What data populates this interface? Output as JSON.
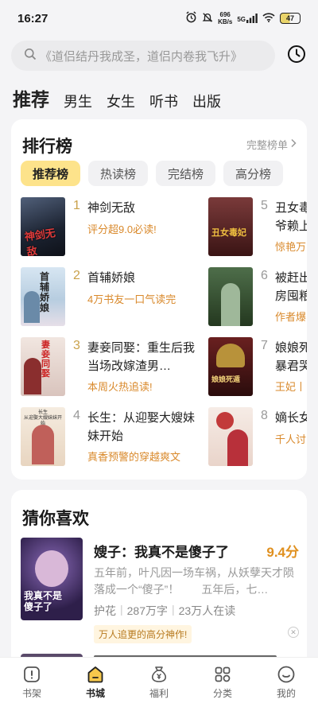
{
  "status": {
    "time": "16:27",
    "net_speed": "696",
    "net_unit": "KB/s",
    "signal": "5G",
    "battery": "47"
  },
  "search": {
    "placeholder": "《道侣结丹我成圣，道侣内卷我飞升》"
  },
  "tabs": [
    {
      "label": "推荐",
      "active": true
    },
    {
      "label": "男生"
    },
    {
      "label": "女生"
    },
    {
      "label": "听书"
    },
    {
      "label": "出版"
    }
  ],
  "ranking": {
    "title": "排行榜",
    "full_list_label": "完整榜单",
    "tabs": [
      "推荐榜",
      "热读榜",
      "完结榜",
      "高分榜"
    ],
    "items": [
      {
        "rank": "1",
        "name": "神剑无敌",
        "tag": "评分超9.0必读!",
        "cover_color": "#1f2a3a"
      },
      {
        "rank": "2",
        "name": "首辅娇娘",
        "tag": "4万书友一口气读完",
        "cover_color": "#cfe0ee"
      },
      {
        "rank": "3",
        "name": "妻妾同娶：重生后我当场改嫁渣男…",
        "tag": "本周火热追读!",
        "cover_color": "#e9dcd6"
      },
      {
        "rank": "4",
        "name": "长生：从迎娶大嫂妹妹开始",
        "tag": "真香预警的穿越爽文",
        "cover_color": "#efe2d2"
      },
      {
        "rank": "5",
        "name": "丑女毒",
        "name2": "爷赖上",
        "tag": "惊艳万",
        "cover_color": "#6a2a2a"
      },
      {
        "rank": "6",
        "name": "被赶出",
        "name2": "房囤粮",
        "tag": "作者爆",
        "cover_color": "#3c5a3a"
      },
      {
        "rank": "7",
        "name": "娘娘死",
        "name2": "暴君哭",
        "tag": "王妃丨",
        "cover_color": "#5a1c1c"
      },
      {
        "rank": "8",
        "name": "嫡长女",
        "tag": "千人讨",
        "cover_color": "#f4e6de"
      }
    ]
  },
  "recommend": {
    "title": "猜你喜欢",
    "book": {
      "name": "嫂子：我真不是傻子了",
      "score": "9.4分",
      "desc": "五年前，叶凡因一场车祸，从妖孽天才陨落成一个“傻子”！　　五年后，七…",
      "genre": "护花",
      "words": "287万字",
      "readers": "23万人在读",
      "badge": "万人追更的高分神作!",
      "cover_color": "#3a2a5a"
    }
  },
  "bottom_nav": [
    {
      "label": "书架",
      "icon": "bookshelf-icon"
    },
    {
      "label": "书城",
      "icon": "bookstore-icon",
      "active": true
    },
    {
      "label": "福利",
      "icon": "money-bag-icon"
    },
    {
      "label": "分类",
      "icon": "category-grid-icon"
    },
    {
      "label": "我的",
      "icon": "profile-smile-icon"
    }
  ]
}
